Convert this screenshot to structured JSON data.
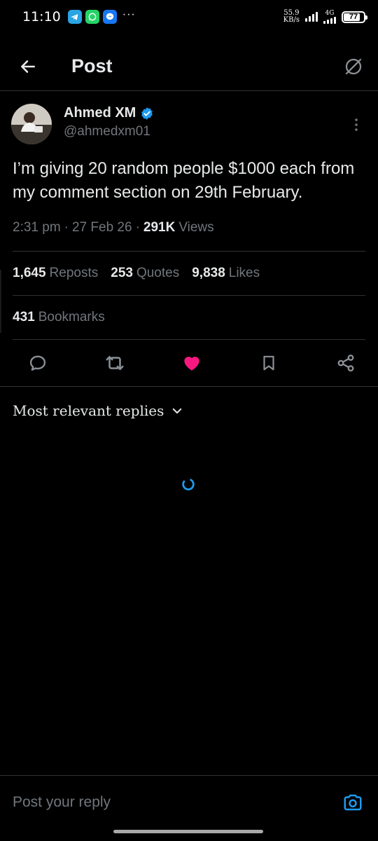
{
  "status_bar": {
    "time": "11:10",
    "notifications": [
      "telegram-icon",
      "whatsapp-icon",
      "messenger-icon"
    ],
    "more": "···",
    "net_speed_value": "55.9",
    "net_speed_unit": "KB/s",
    "network_type": "4G",
    "battery_level": "77",
    "battery_fraction": 0.77
  },
  "header": {
    "title": "Post",
    "back_icon": "arrow-left-icon",
    "grok_icon": "grok-icon"
  },
  "post": {
    "author": {
      "name": "Ahmed XM",
      "handle": "@ahmedxm01",
      "verified": true
    },
    "text": "I’m giving 20 random people $1000 each from my comment section on 29th February.",
    "time": "2:31 pm",
    "date": "27 Feb 26",
    "views_count": "291K",
    "views_label": "Views",
    "separator": "·"
  },
  "stats": {
    "reposts_count": "1,645",
    "reposts_label": "Reposts",
    "quotes_count": "253",
    "quotes_label": "Quotes",
    "likes_count": "9,838",
    "likes_label": "Likes",
    "bookmarks_count": "431",
    "bookmarks_label": "Bookmarks"
  },
  "actions": [
    "reply-icon",
    "repost-icon",
    "like-icon",
    "bookmark-icon",
    "share-icon"
  ],
  "colors": {
    "accent": "#1d9bf0",
    "like": "#f91880",
    "muted": "#71767b",
    "text": "#e7e9ea",
    "divider": "#2f3336"
  },
  "replies": {
    "sort_label": "Most relevant replies"
  },
  "reply_bar": {
    "placeholder": "Post your reply"
  }
}
